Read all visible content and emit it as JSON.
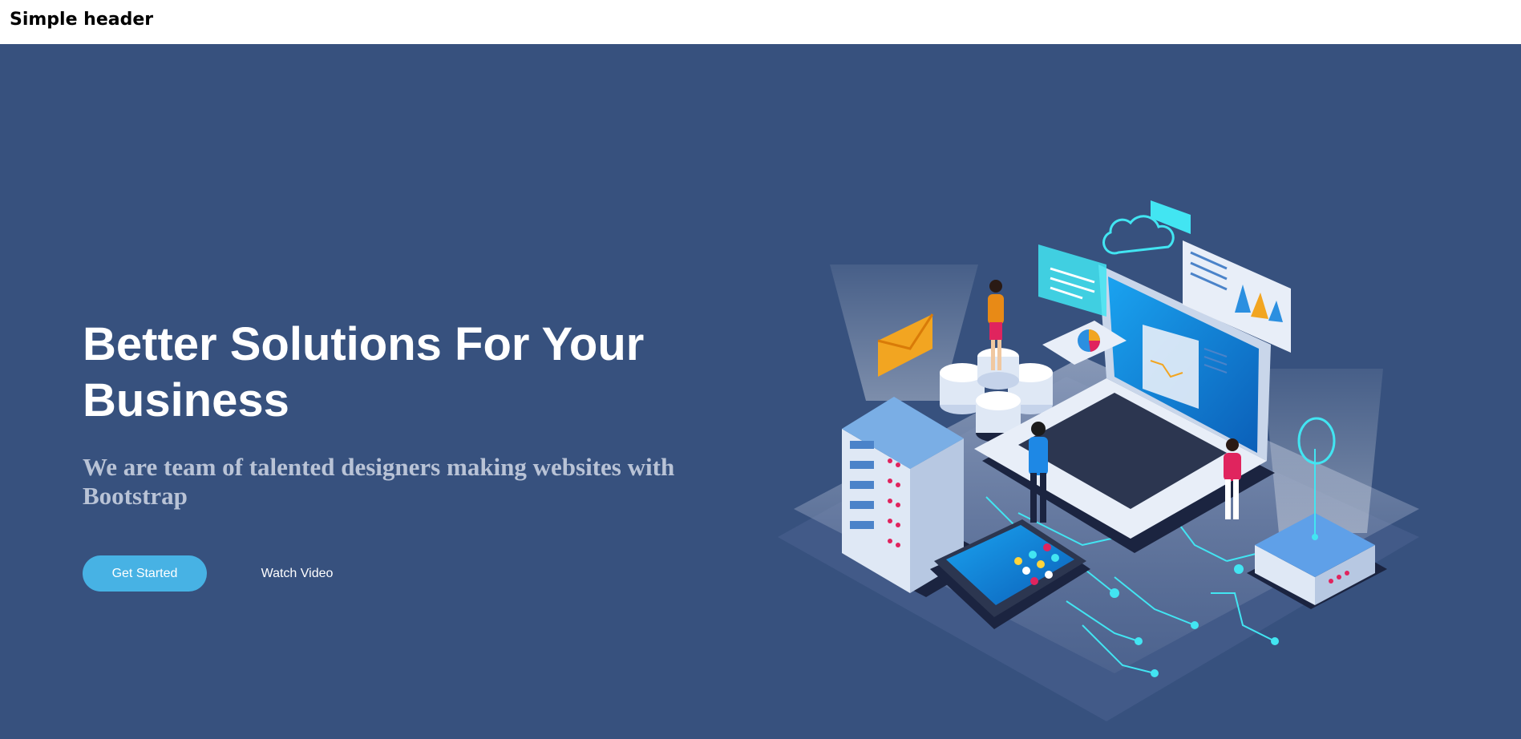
{
  "header": {
    "title": "Simple header"
  },
  "hero": {
    "title": "Better Solutions For Your Business",
    "subtitle": "We are team of talented designers making websites with Bootstrap",
    "primary_button": "Get Started",
    "secondary_button": "Watch Video"
  },
  "colors": {
    "hero_background": "#37517e",
    "accent": "#47b2e4",
    "header_background": "#ffffff"
  },
  "illustration": {
    "name": "isometric-tech-illustration"
  }
}
